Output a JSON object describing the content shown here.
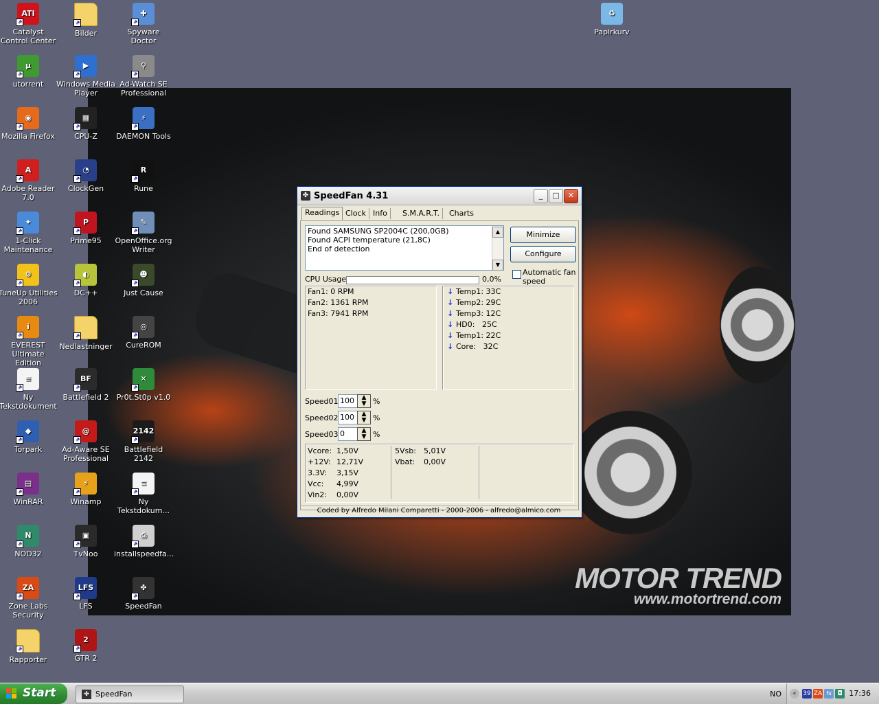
{
  "desktop": {
    "icons": [
      {
        "label": "Catalyst Control Center",
        "icon": "ati-icon",
        "color": "#d0121b",
        "glyph": "ATI"
      },
      {
        "label": "Bilder",
        "icon": "folder-icon",
        "color": "#f4d46a",
        "glyph": ""
      },
      {
        "label": "Spyware Doctor",
        "icon": "spyware-doctor-icon",
        "color": "#5a8fd8",
        "glyph": "✚"
      },
      {
        "label": "utorrent",
        "icon": "utorrent-icon",
        "color": "#3f9a2f",
        "glyph": "µ"
      },
      {
        "label": "Windows Media Player",
        "icon": "media-player-icon",
        "color": "#2f6fd0",
        "glyph": "▶"
      },
      {
        "label": "Ad-Watch SE Professional",
        "icon": "ad-watch-icon",
        "color": "#8a8a8a",
        "glyph": "⚲"
      },
      {
        "label": "Mozilla Firefox",
        "icon": "firefox-icon",
        "color": "#e56a1c",
        "glyph": "◉"
      },
      {
        "label": "CPU-Z",
        "icon": "cpu-z-icon",
        "color": "#222222",
        "glyph": "▦"
      },
      {
        "label": "DAEMON Tools",
        "icon": "daemon-tools-icon",
        "color": "#3b6fc4",
        "glyph": "⚡"
      },
      {
        "label": "Adobe Reader 7.0",
        "icon": "adobe-reader-icon",
        "color": "#d11f1f",
        "glyph": "A"
      },
      {
        "label": "ClockGen",
        "icon": "clockgen-icon",
        "color": "#2a3f8a",
        "glyph": "◔"
      },
      {
        "label": "Rune",
        "icon": "rune-icon",
        "color": "#111111",
        "glyph": "R"
      },
      {
        "label": "1-Click Maintenance",
        "icon": "maintenance-icon",
        "color": "#4a8ad8",
        "glyph": "✦"
      },
      {
        "label": "Prime95",
        "icon": "prime95-icon",
        "color": "#c0141e",
        "glyph": "P"
      },
      {
        "label": "OpenOffice.org Writer",
        "icon": "openoffice-writer-icon",
        "color": "#6f8fb8",
        "glyph": "✎"
      },
      {
        "label": "TuneUp Utilities 2006",
        "icon": "tuneup-icon",
        "color": "#f2c21b",
        "glyph": "⚙"
      },
      {
        "label": "DC++",
        "icon": "dcpp-icon",
        "color": "#b8c43a",
        "glyph": "◐"
      },
      {
        "label": "Just Cause",
        "icon": "just-cause-icon",
        "color": "#3a4a2a",
        "glyph": "☻"
      },
      {
        "label": "EVEREST Ultimate Edition",
        "icon": "everest-icon",
        "color": "#e68a12",
        "glyph": "i"
      },
      {
        "label": "Nedlastninger",
        "icon": "folder-icon",
        "color": "#f4d46a",
        "glyph": ""
      },
      {
        "label": "CureROM",
        "icon": "curerom-icon",
        "color": "#444444",
        "glyph": "◎"
      },
      {
        "label": "Ny Tekstdokument",
        "icon": "text-document-icon",
        "color": "#f4f4f4",
        "glyph": "≡"
      },
      {
        "label": "Battlefield 2",
        "icon": "battlefield2-icon",
        "color": "#2b2b2b",
        "glyph": "BF"
      },
      {
        "label": "Pr0t.St0p v1.0",
        "icon": "prot-stop-icon",
        "color": "#2e8b3a",
        "glyph": "✕"
      },
      {
        "label": "Torpark",
        "icon": "torpark-icon",
        "color": "#2f5fb0",
        "glyph": "◆"
      },
      {
        "label": "Ad-Aware SE Professional",
        "icon": "ad-aware-icon",
        "color": "#c41a1a",
        "glyph": "@"
      },
      {
        "label": "Battlefield 2142",
        "icon": "battlefield2142-icon",
        "color": "#1b1b1b",
        "glyph": "2142"
      },
      {
        "label": "WinRAR",
        "icon": "winrar-icon",
        "color": "#7a2f8a",
        "glyph": "▤"
      },
      {
        "label": "Winamp",
        "icon": "winamp-icon",
        "color": "#e8a11a",
        "glyph": "⚡"
      },
      {
        "label": "Ny Tekstdokum...",
        "icon": "text-document-icon",
        "color": "#f4f4f4",
        "glyph": "≡"
      },
      {
        "label": "NOD32",
        "icon": "nod32-icon",
        "color": "#2e8a6a",
        "glyph": "N"
      },
      {
        "label": "TvNoo",
        "icon": "tvnoo-icon",
        "color": "#2a2a2a",
        "glyph": "▣"
      },
      {
        "label": "installspeedfa...",
        "icon": "installer-icon",
        "color": "#d0d0d0",
        "glyph": "⎙"
      },
      {
        "label": "Zone Labs Security",
        "icon": "zonealarm-icon",
        "color": "#d94a14",
        "glyph": "ZA"
      },
      {
        "label": "LFS",
        "icon": "lfs-icon",
        "color": "#1f3a8a",
        "glyph": "LFS"
      },
      {
        "label": "SpeedFan",
        "icon": "speedfan-icon",
        "color": "#333333",
        "glyph": "✤"
      },
      {
        "label": "Rapporter",
        "icon": "folder-icon",
        "color": "#f4d46a",
        "glyph": ""
      },
      {
        "label": "GTR 2",
        "icon": "gtr2-icon",
        "color": "#b01515",
        "glyph": "2"
      },
      {
        "label": "Papirkurv",
        "icon": "recycle-bin-icon",
        "color": "#7ab8e8",
        "glyph": "♻"
      }
    ],
    "wallpaper": {
      "brand_line1": "MOTOR TREND",
      "brand_line2": "www.motortrend.com"
    }
  },
  "speedfan": {
    "title": "SpeedFan 4.31",
    "tabs": [
      "Readings",
      "Clock",
      "Info",
      "S.M.A.R.T.",
      "Charts"
    ],
    "active_tab": "Readings",
    "log": [
      "Found SAMSUNG SP2004C (200,0GB)",
      "Found ACPI temperature (21,8C)",
      "End of detection"
    ],
    "minimize_label": "Minimize",
    "configure_label": "Configure",
    "auto_fan_label": "Automatic fan speed",
    "auto_fan_checked": false,
    "cpu_usage_label": "CPU Usage",
    "cpu_usage_value": "0,0%",
    "cpu_usage_fraction": 0.0,
    "fans": [
      "Fan1: 0 RPM",
      "Fan2: 1361 RPM",
      "Fan3: 7941 RPM"
    ],
    "temps": [
      {
        "label": "Temp1:",
        "value": "33C"
      },
      {
        "label": "Temp2:",
        "value": "29C"
      },
      {
        "label": "Temp3:",
        "value": "12C"
      },
      {
        "label": "HD0:",
        "value": "25C"
      },
      {
        "label": "Temp1:",
        "value": "22C"
      },
      {
        "label": "Core:",
        "value": "32C"
      }
    ],
    "speeds": [
      {
        "label": "Speed01:",
        "value": "100",
        "unit": "%"
      },
      {
        "label": "Speed02:",
        "value": "100",
        "unit": "%"
      },
      {
        "label": "Speed03:",
        "value": "0",
        "unit": "%"
      }
    ],
    "volts_left": [
      {
        "label": "Vcore:",
        "value": "1,50V"
      },
      {
        "label": "+12V:",
        "value": "12,71V"
      },
      {
        "label": "3.3V:",
        "value": "3,15V"
      },
      {
        "label": "Vcc:",
        "value": "4,99V"
      },
      {
        "label": "Vin2:",
        "value": "0,00V"
      }
    ],
    "volts_right": [
      {
        "label": "5Vsb:",
        "value": "5,01V"
      },
      {
        "label": "Vbat:",
        "value": "0,00V"
      }
    ],
    "status": "Coded by Alfredo Milani Comparetti - 2000-2006 - alfredo@almico.com"
  },
  "taskbar": {
    "start_label": "Start",
    "task_label": "SpeedFan",
    "language": "NO",
    "clock": "17:36"
  }
}
